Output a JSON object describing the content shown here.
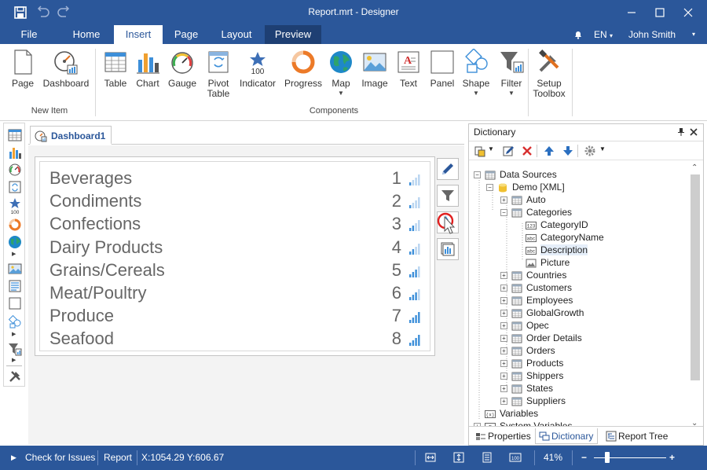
{
  "window": {
    "title": "Report.mrt - Designer"
  },
  "menu": {
    "tabs": [
      "File",
      "Home",
      "Insert",
      "Page",
      "Layout",
      "Preview"
    ],
    "active_tab": "Insert",
    "language": "EN",
    "user": "John Smith"
  },
  "ribbon": {
    "groups": [
      {
        "label": "New Item",
        "items": [
          {
            "label": "Page",
            "icon": "page-icon"
          },
          {
            "label": "Dashboard",
            "icon": "dashboard-icon"
          }
        ]
      },
      {
        "label": "Components",
        "items": [
          {
            "label": "Table",
            "icon": "table-icon"
          },
          {
            "label": "Chart",
            "icon": "chart-icon"
          },
          {
            "label": "Gauge",
            "icon": "gauge-icon"
          },
          {
            "label": "Pivot\nTable",
            "icon": "pivot-table-icon"
          },
          {
            "label": "Indicator",
            "icon": "indicator-icon",
            "value": "100"
          },
          {
            "label": "Progress",
            "icon": "progress-icon"
          },
          {
            "label": "Map",
            "icon": "map-icon"
          },
          {
            "label": "Image",
            "icon": "image-icon"
          },
          {
            "label": "Text",
            "icon": "text-icon"
          },
          {
            "label": "Panel",
            "icon": "panel-icon"
          },
          {
            "label": "Shape",
            "icon": "shape-icon"
          },
          {
            "label": "Filter",
            "icon": "filter-icon"
          }
        ]
      },
      {
        "label": "",
        "items": [
          {
            "label": "Setup\nToolbox",
            "icon": "setup-toolbox-icon"
          }
        ]
      }
    ]
  },
  "left_toolbar": {
    "indicator_value": "100"
  },
  "document_tab": {
    "label": "Dashboard1"
  },
  "dashboard_list": {
    "items": [
      {
        "name": "Beverages",
        "rank": "1"
      },
      {
        "name": "Condiments",
        "rank": "2"
      },
      {
        "name": "Confections",
        "rank": "3"
      },
      {
        "name": "Dairy Products",
        "rank": "4"
      },
      {
        "name": "Grains/Cereals",
        "rank": "5"
      },
      {
        "name": "Meat/Poultry",
        "rank": "6"
      },
      {
        "name": "Produce",
        "rank": "7"
      },
      {
        "name": "Seafood",
        "rank": "8"
      }
    ]
  },
  "dictionary": {
    "title": "Dictionary",
    "tree": [
      {
        "label": "Data Sources",
        "level": 0,
        "expand": "−",
        "icon": "datasource"
      },
      {
        "label": "Demo [XML]",
        "level": 1,
        "expand": "−",
        "icon": "db"
      },
      {
        "label": "Auto",
        "level": 2,
        "expand": "+",
        "icon": "table"
      },
      {
        "label": "Categories",
        "level": 2,
        "expand": "−",
        "icon": "table"
      },
      {
        "label": "CategoryID",
        "level": 3,
        "expand": "",
        "icon": "num",
        "badge": "123"
      },
      {
        "label": "CategoryName",
        "level": 3,
        "expand": "",
        "icon": "txt",
        "badge": "abc"
      },
      {
        "label": "Description",
        "level": 3,
        "expand": "",
        "icon": "txt",
        "badge": "abc",
        "selected": true
      },
      {
        "label": "Picture",
        "level": 3,
        "expand": "",
        "icon": "img"
      },
      {
        "label": "Countries",
        "level": 2,
        "expand": "+",
        "icon": "table"
      },
      {
        "label": "Customers",
        "level": 2,
        "expand": "+",
        "icon": "table"
      },
      {
        "label": "Employees",
        "level": 2,
        "expand": "+",
        "icon": "table"
      },
      {
        "label": "GlobalGrowth",
        "level": 2,
        "expand": "+",
        "icon": "table"
      },
      {
        "label": "Opec",
        "level": 2,
        "expand": "+",
        "icon": "table"
      },
      {
        "label": "Order Details",
        "level": 2,
        "expand": "+",
        "icon": "table"
      },
      {
        "label": "Orders",
        "level": 2,
        "expand": "+",
        "icon": "table"
      },
      {
        "label": "Products",
        "level": 2,
        "expand": "+",
        "icon": "table"
      },
      {
        "label": "Shippers",
        "level": 2,
        "expand": "+",
        "icon": "table"
      },
      {
        "label": "States",
        "level": 2,
        "expand": "+",
        "icon": "table"
      },
      {
        "label": "Suppliers",
        "level": 2,
        "expand": "+",
        "icon": "table"
      },
      {
        "label": "Variables",
        "level": 0,
        "expand": "",
        "icon": "var",
        "badge": "(x)"
      },
      {
        "label": "System Variables",
        "level": 0,
        "expand": "+",
        "icon": "sysvar",
        "badge": "Σ"
      }
    ],
    "bottom_tabs": [
      "Properties",
      "Dictionary",
      "Report Tree"
    ],
    "active_bottom_tab": "Dictionary"
  },
  "status_bar": {
    "check": "Check for Issues",
    "report": "Report",
    "coords": "X:1054.29 Y:606.67",
    "zoom": "41%",
    "zoom_minus": "−",
    "zoom_plus": "+",
    "zoom_level": 0.41
  },
  "colors": {
    "accent": "#2b579a",
    "chart_blue": "#3d8fd9"
  }
}
